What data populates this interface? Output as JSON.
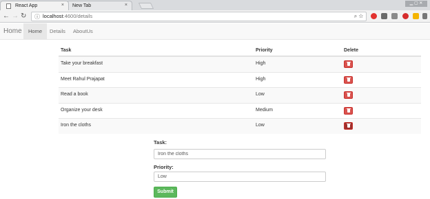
{
  "browser": {
    "tabs": [
      {
        "label": "React App",
        "close": "×"
      },
      {
        "label": "New Tab",
        "close": "×"
      }
    ],
    "window_controls": "▁ ▢ ✕",
    "url_host": "localhost",
    "url_rest": ":4600/details"
  },
  "navbar": {
    "brand": "Home",
    "links": [
      "Home",
      "Details",
      "AboutUs"
    ],
    "active": "Home"
  },
  "table": {
    "headers": {
      "task": "Task",
      "priority": "Priority",
      "delete": "Delete"
    },
    "rows": [
      {
        "task": "Take your breakfast",
        "priority": "High"
      },
      {
        "task": "Meet Rahul Prajapat",
        "priority": "High"
      },
      {
        "task": "Read a book",
        "priority": "Low"
      },
      {
        "task": "Organize your desk",
        "priority": "Medium"
      },
      {
        "task": "Iron the cloths",
        "priority": "Low"
      }
    ]
  },
  "form": {
    "task_label": "Task:",
    "task_value": "Iron the cloths",
    "priority_label": "Priority:",
    "priority_value": "Low",
    "submit_label": "Submit"
  },
  "colors": {
    "delete_button": "#d9534f",
    "submit_button": "#5cb85c",
    "stripe": "#f9f9f9"
  }
}
